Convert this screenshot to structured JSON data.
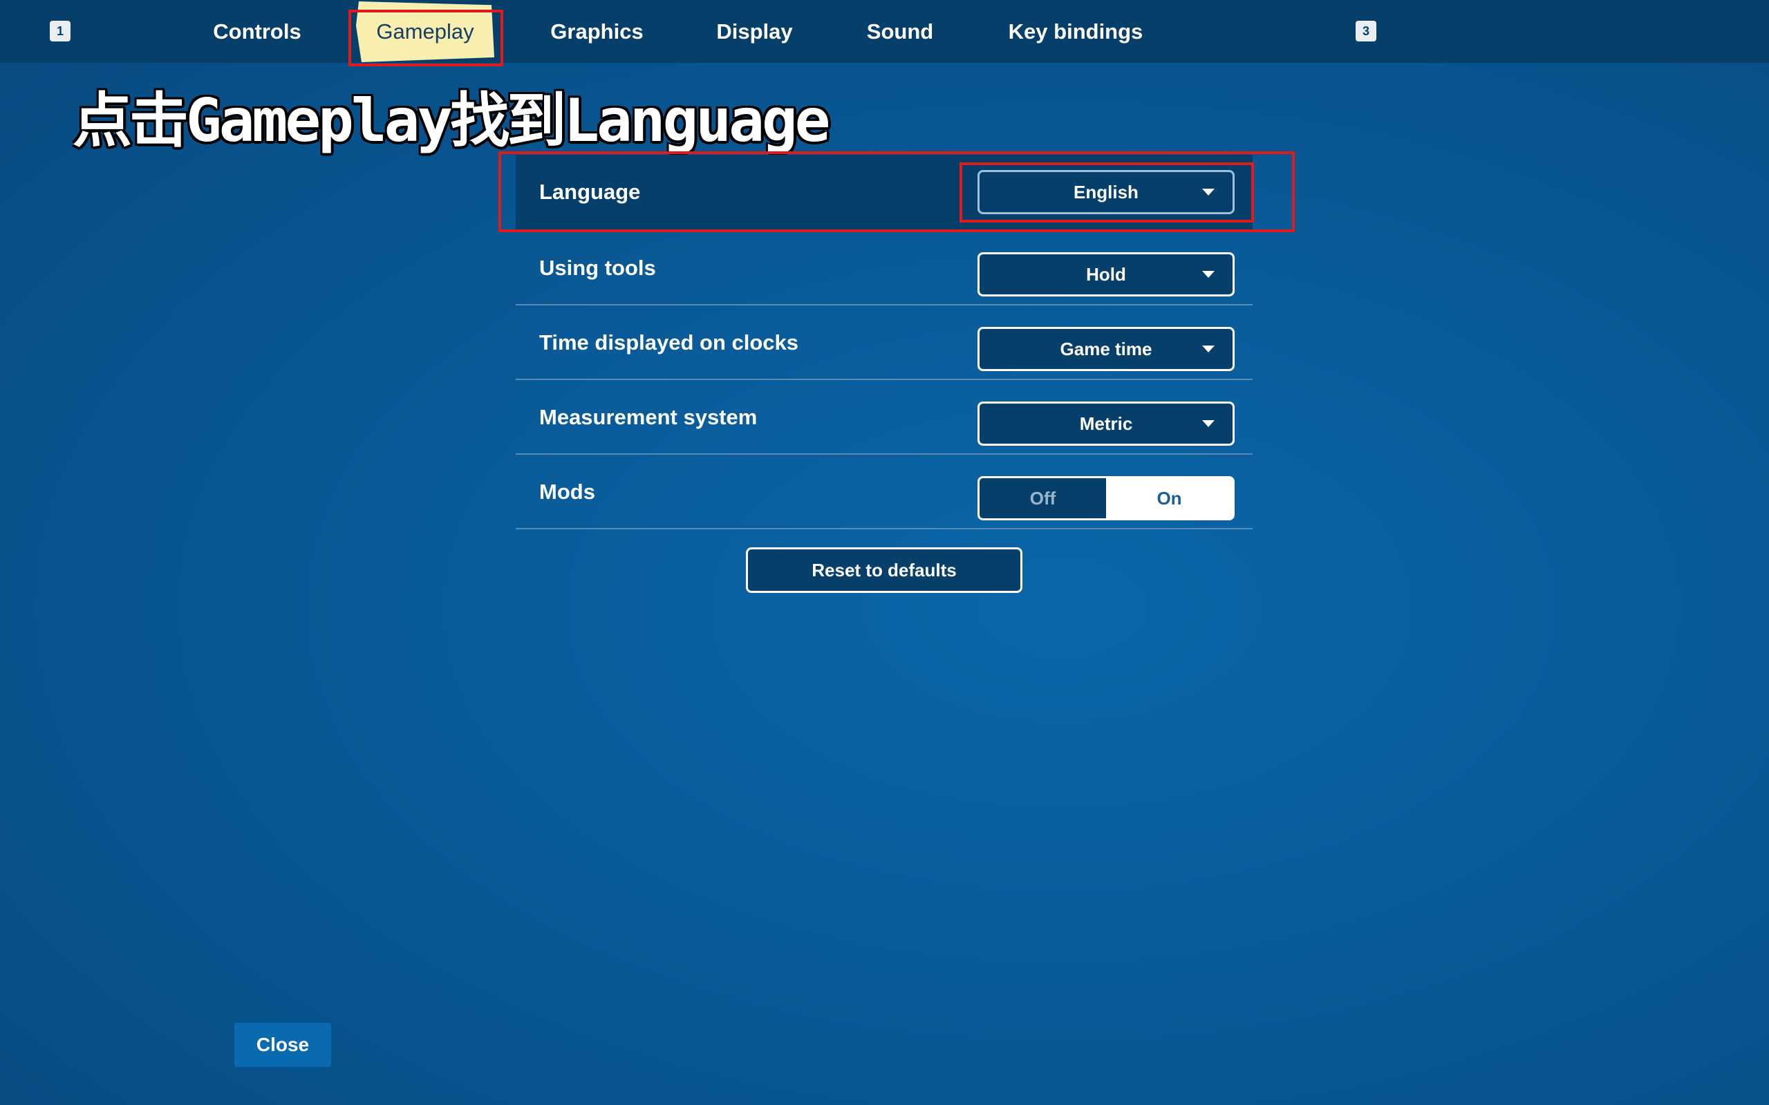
{
  "topbar": {
    "left_key": "1",
    "right_key": "3",
    "tabs": [
      {
        "label": "Controls"
      },
      {
        "label": "Gameplay",
        "active": true
      },
      {
        "label": "Graphics"
      },
      {
        "label": "Display"
      },
      {
        "label": "Sound"
      },
      {
        "label": "Key bindings"
      }
    ]
  },
  "annotation": "点击Gameplay找到Language",
  "settings": {
    "rows": [
      {
        "label": "Language",
        "value": "English"
      },
      {
        "label": "Using tools",
        "value": "Hold"
      },
      {
        "label": "Time displayed on clocks",
        "value": "Game time"
      },
      {
        "label": "Measurement system",
        "value": "Metric"
      },
      {
        "label": "Mods",
        "off_label": "Off",
        "on_label": "On",
        "selected": "Off"
      }
    ],
    "reset_label": "Reset to defaults"
  },
  "close_label": "Close",
  "colors": {
    "background": "#095a97",
    "bar": "#073f6b",
    "active_tab": "#f7eeb0",
    "annotation_box": "#e11b1b"
  }
}
